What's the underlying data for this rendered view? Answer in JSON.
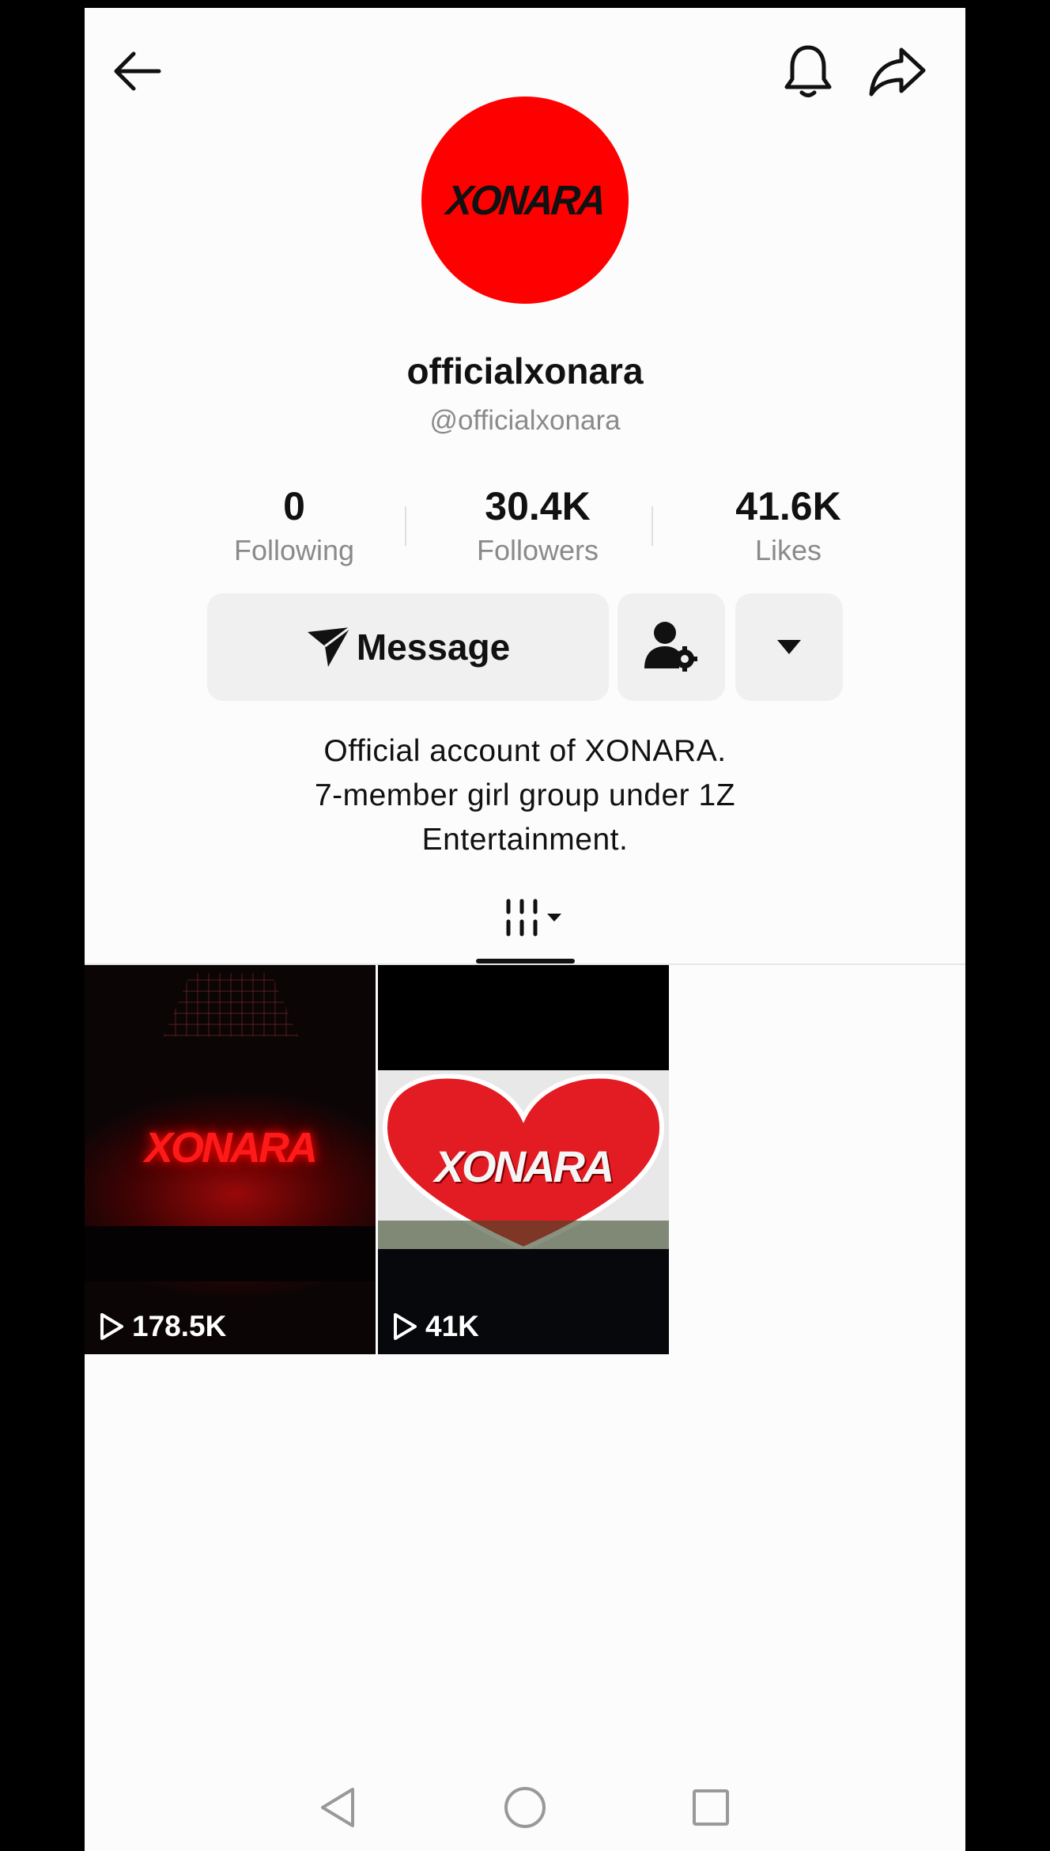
{
  "header": {
    "back_icon": "arrow-left-icon",
    "bell_icon": "bell-icon",
    "share_icon": "share-arrow-icon"
  },
  "profile": {
    "avatar_text": "XONARA",
    "avatar_color": "#ff0000",
    "display_name": "officialxonara",
    "handle": "@officialxonara"
  },
  "stats": [
    {
      "value": "0",
      "label": "Following"
    },
    {
      "value": "30.4K",
      "label": "Followers"
    },
    {
      "value": "41.6K",
      "label": "Likes"
    }
  ],
  "actions": {
    "message_label": "Message",
    "message_icon": "send-icon",
    "friends_icon": "person-gear-icon",
    "more_icon": "caret-down-icon"
  },
  "bio": {
    "line1": "Official account of XONARA.",
    "line2": "7-member girl group under 1Z",
    "line3": "Entertainment."
  },
  "tabs": {
    "videos_icon": "grid-videos-icon"
  },
  "videos": [
    {
      "title_art": "XONARA",
      "views": "178.5K"
    },
    {
      "title_art": "XONARA",
      "views": "41K"
    }
  ],
  "system_nav": [
    "back-triangle-icon",
    "home-circle-icon",
    "recents-square-icon"
  ]
}
